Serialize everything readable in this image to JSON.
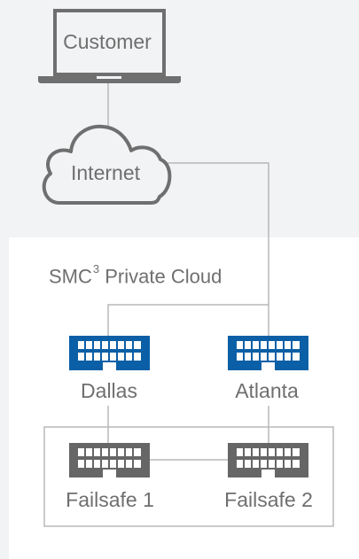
{
  "diagram": {
    "customer_label": "Customer",
    "internet_label": "Internet",
    "private_cloud_title": "SMC",
    "private_cloud_superscript": "3",
    "private_cloud_suffix": " Private Cloud",
    "nodes": {
      "dallas": "Dallas",
      "atlanta": "Atlanta",
      "failsafe_1": "Failsafe 1",
      "failsafe_2": "Failsafe 2"
    },
    "icons": {
      "customer": "laptop-icon",
      "internet": "cloud-icon",
      "primary_datacenter": "building-icon",
      "failsafe_datacenter": "building-icon"
    }
  },
  "colors": {
    "background_top": "#f2f3f5",
    "background_panel": "#ffffff",
    "primary_building": "#0a5fa6",
    "failsafe_building": "#666666",
    "line": "#b8b8b8",
    "text": "#6f6f6f"
  }
}
